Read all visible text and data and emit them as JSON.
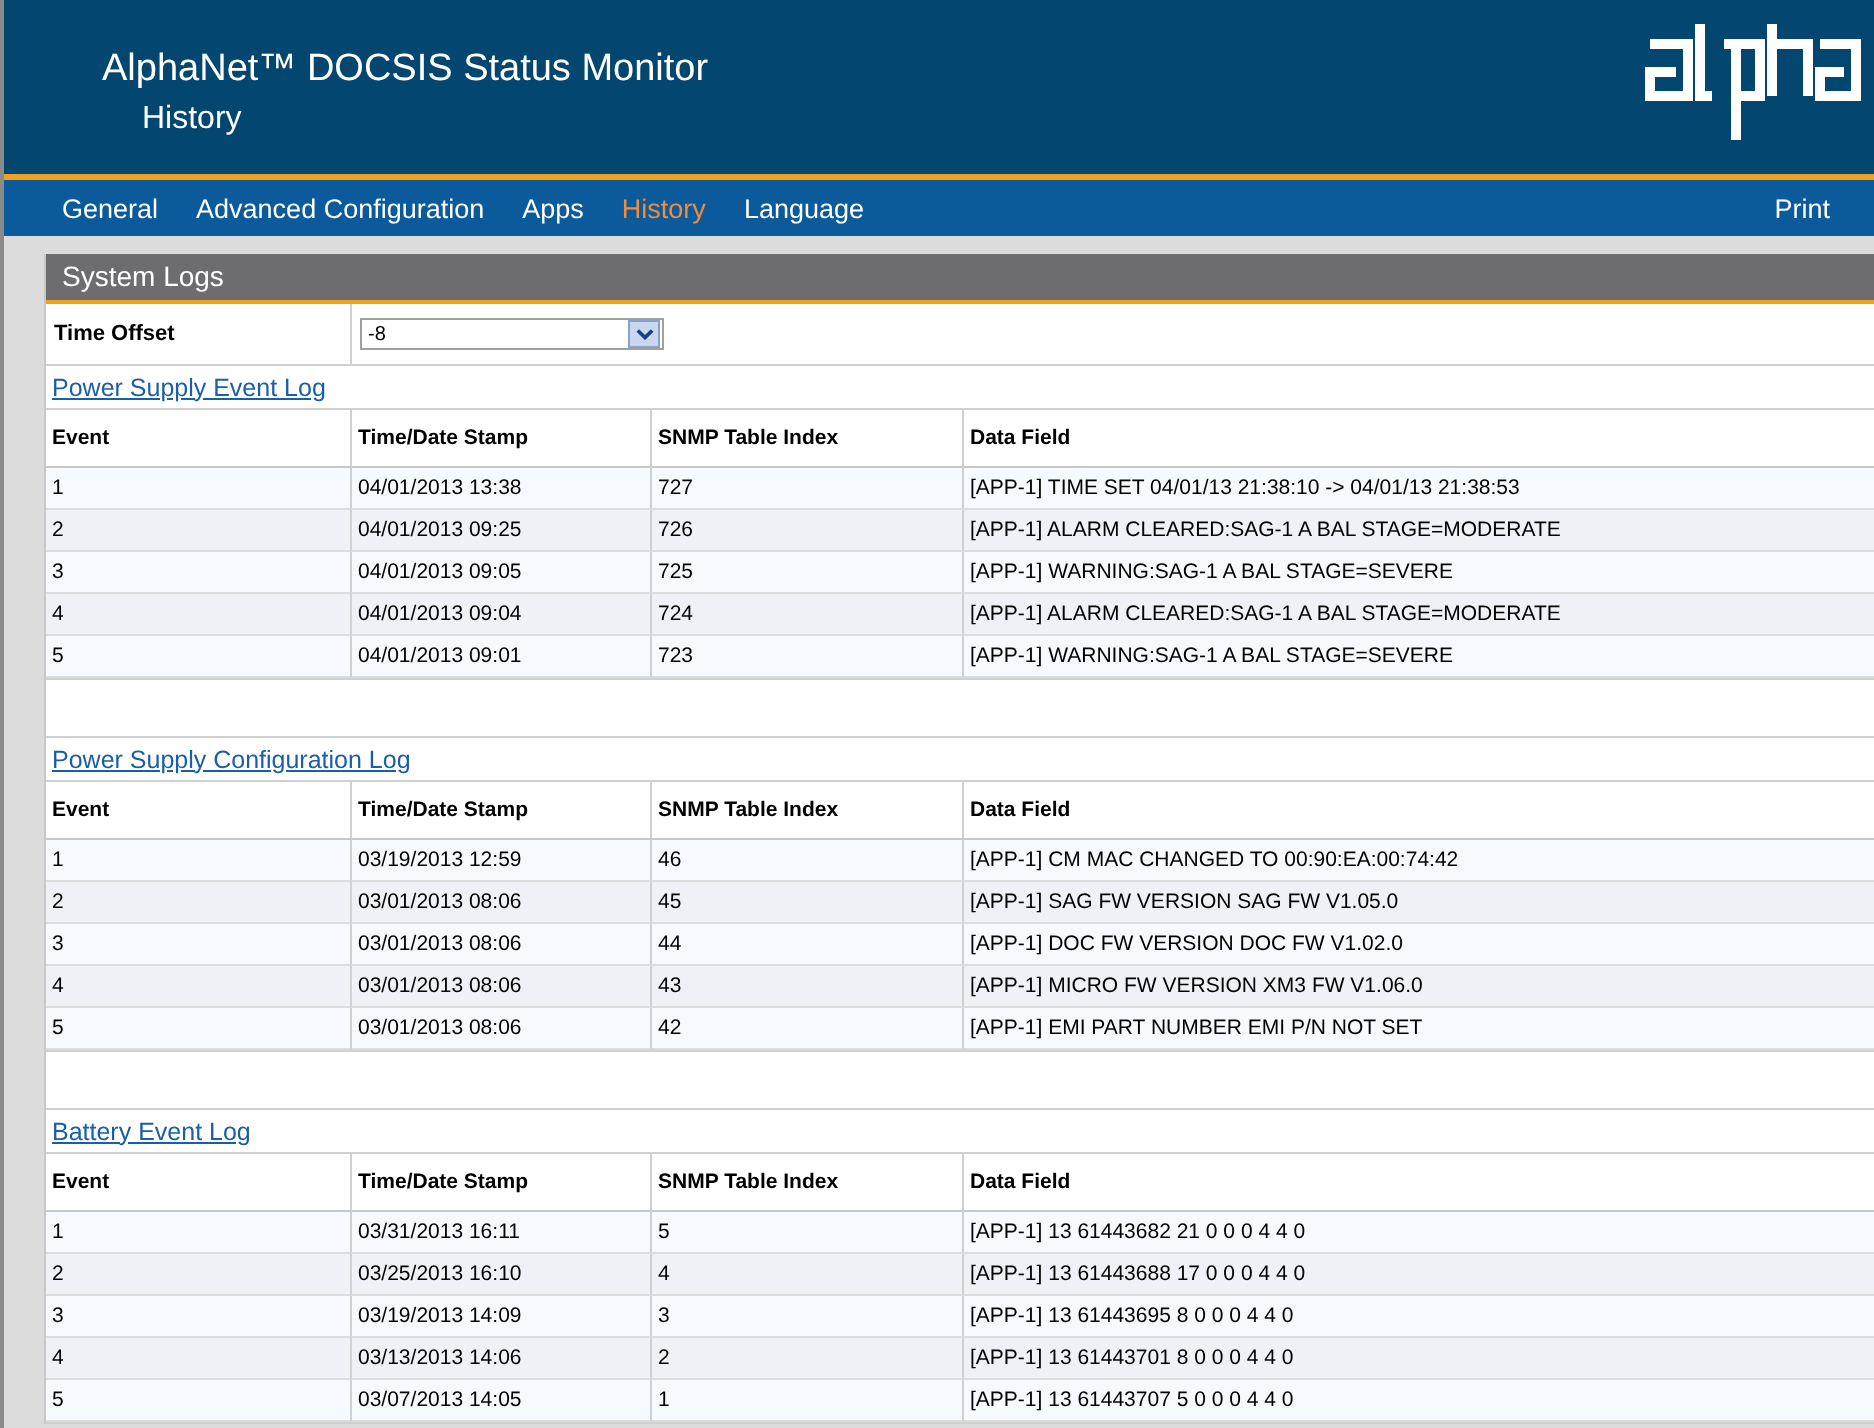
{
  "header": {
    "title": "AlphaNet™ DOCSIS Status Monitor",
    "subtitle": "History"
  },
  "nav": [
    {
      "label": "General",
      "selected": false
    },
    {
      "label": "Advanced Configuration",
      "selected": false
    },
    {
      "label": "Apps",
      "selected": false
    },
    {
      "label": "History",
      "selected": true
    },
    {
      "label": "Language",
      "selected": false
    }
  ],
  "print": "Print",
  "panel": {
    "title": "System Logs",
    "time_offset": {
      "label": "Time Offset",
      "value": "-8"
    }
  },
  "logs": [
    {
      "title": "Power Supply Event Log",
      "columns": [
        "Event",
        "Time/Date Stamp",
        "SNMP Table Index",
        "Data Field"
      ],
      "rows": [
        [
          "1",
          "04/01/2013 13:38",
          "727",
          "[APP-1] TIME SET 04/01/13 21:38:10 -> 04/01/13 21:38:53"
        ],
        [
          "2",
          "04/01/2013 09:25",
          "726",
          "[APP-1] ALARM CLEARED:SAG-1 A BAL STAGE=MODERATE"
        ],
        [
          "3",
          "04/01/2013 09:05",
          "725",
          "[APP-1] WARNING:SAG-1 A BAL STAGE=SEVERE"
        ],
        [
          "4",
          "04/01/2013 09:04",
          "724",
          "[APP-1] ALARM CLEARED:SAG-1 A BAL STAGE=MODERATE"
        ],
        [
          "5",
          "04/01/2013 09:01",
          "723",
          "[APP-1] WARNING:SAG-1 A BAL STAGE=SEVERE"
        ]
      ]
    },
    {
      "title": "Power Supply Configuration Log",
      "columns": [
        "Event",
        "Time/Date Stamp",
        "SNMP Table Index",
        "Data Field"
      ],
      "rows": [
        [
          "1",
          "03/19/2013 12:59",
          "46",
          "[APP-1] CM MAC CHANGED TO 00:90:EA:00:74:42"
        ],
        [
          "2",
          "03/01/2013 08:06",
          "45",
          "[APP-1] SAG FW VERSION SAG FW V1.05.0"
        ],
        [
          "3",
          "03/01/2013 08:06",
          "44",
          "[APP-1] DOC FW VERSION DOC FW V1.02.0"
        ],
        [
          "4",
          "03/01/2013 08:06",
          "43",
          "[APP-1] MICRO FW VERSION XM3 FW V1.06.0"
        ],
        [
          "5",
          "03/01/2013 08:06",
          "42",
          "[APP-1] EMI PART NUMBER EMI P/N NOT SET"
        ]
      ]
    },
    {
      "title": "Battery Event Log",
      "columns": [
        "Event",
        "Time/Date Stamp",
        "SNMP Table Index",
        "Data Field"
      ],
      "rows": [
        [
          "1",
          "03/31/2013 16:11",
          "5",
          "[APP-1] 13 61443682 21 0 0 0 4 4 0"
        ],
        [
          "2",
          "03/25/2013 16:10",
          "4",
          "[APP-1] 13 61443688 17 0 0 0 4 4 0"
        ],
        [
          "3",
          "03/19/2013 14:09",
          "3",
          "[APP-1] 13 61443695 8 0 0 0 4 4 0"
        ],
        [
          "4",
          "03/13/2013 14:06",
          "2",
          "[APP-1] 13 61443701 8 0 0 0 4 4 0"
        ],
        [
          "5",
          "03/07/2013 14:05",
          "1",
          "[APP-1] 13 61443707 5 0 0 0 4 4 0"
        ]
      ]
    }
  ]
}
